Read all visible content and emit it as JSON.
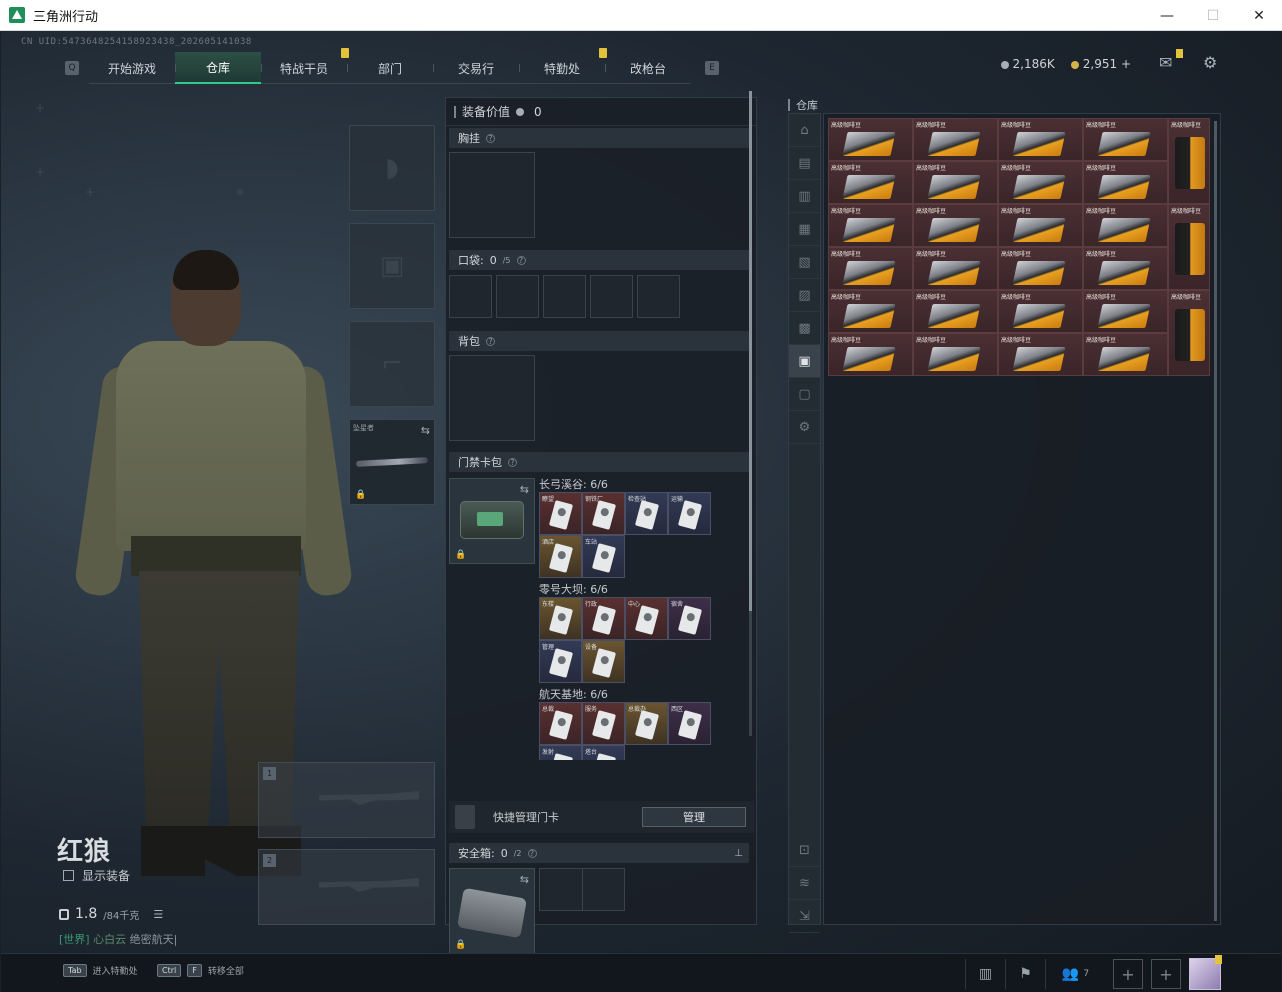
{
  "window": {
    "title": "三角洲行动",
    "min": "—",
    "max": "☐",
    "close": "✕"
  },
  "uid": "CN UID:5473648254158923438_202605141038",
  "nav": {
    "tabs": [
      {
        "label": "开始游戏"
      },
      {
        "label": "仓库",
        "active": true
      },
      {
        "label": "特战干员"
      },
      {
        "label": "部门"
      },
      {
        "label": "交易行"
      },
      {
        "label": "特勤处"
      },
      {
        "label": "改枪台"
      }
    ],
    "left_key": "Q",
    "right_key": "E"
  },
  "currency": {
    "silver": "2,186K",
    "gold": "2,951",
    "gold_add": "+"
  },
  "operator": {
    "name": "红狼",
    "show_equipment": "显示装备",
    "weight": "1.8",
    "weight_max": "/84千克",
    "chat": {
      "channel": "[世界]",
      "user": "心白云",
      "text": "绝密航天|"
    }
  },
  "equip_slots": {
    "melee_label": "坠星者"
  },
  "weapon_slots": [
    "1",
    "2"
  ],
  "mid_panel": {
    "equip_value_label": "装备价值",
    "equip_value": "0",
    "chest_rig": "胸挂",
    "pockets": "口袋:",
    "pockets_count": "0",
    "pockets_max": "/5",
    "backpack": "背包",
    "keycard_case": "门禁卡包",
    "maps": [
      {
        "name": "长弓溪谷: 6/6",
        "cards": [
          {
            "t": "瞭望",
            "c": "red"
          },
          {
            "t": "钢铁厂",
            "c": "red"
          },
          {
            "t": "检查站",
            "c": "blue"
          },
          {
            "t": "运输",
            "c": "blue"
          },
          {
            "t": "酒店",
            "c": "gold"
          },
          {
            "t": "车站",
            "c": "blue"
          }
        ]
      },
      {
        "name": "零号大坝: 6/6",
        "cards": [
          {
            "t": "东楼",
            "c": "gold"
          },
          {
            "t": "行政",
            "c": "red"
          },
          {
            "t": "中心",
            "c": "red"
          },
          {
            "t": "宿舍",
            "c": "purple"
          },
          {
            "t": "管理",
            "c": "blue"
          },
          {
            "t": "设备",
            "c": "gold"
          }
        ]
      },
      {
        "name": "航天基地: 6/6",
        "cards": [
          {
            "t": "总裁",
            "c": "red"
          },
          {
            "t": "服务",
            "c": "red"
          },
          {
            "t": "总裁办",
            "c": "gold"
          },
          {
            "t": "西区",
            "c": "purple"
          },
          {
            "t": "发射",
            "c": "blue"
          },
          {
            "t": "塔台",
            "c": "blue"
          }
        ]
      }
    ],
    "quick_manage": "快捷管理门卡",
    "manage_button": "管理",
    "safe_box": "安全箱:",
    "safe_count": "0",
    "safe_max": "/2"
  },
  "warehouse": {
    "title": "仓库",
    "item_label": "高级咖啡豆",
    "bag_label": "高级咖啡豆"
  },
  "bottom": {
    "hint1_key": "Tab",
    "hint1": "进入特勤处",
    "hint2_key1": "Ctrl",
    "hint2_key2": "F",
    "hint2": "转移全部",
    "friends": "7"
  }
}
